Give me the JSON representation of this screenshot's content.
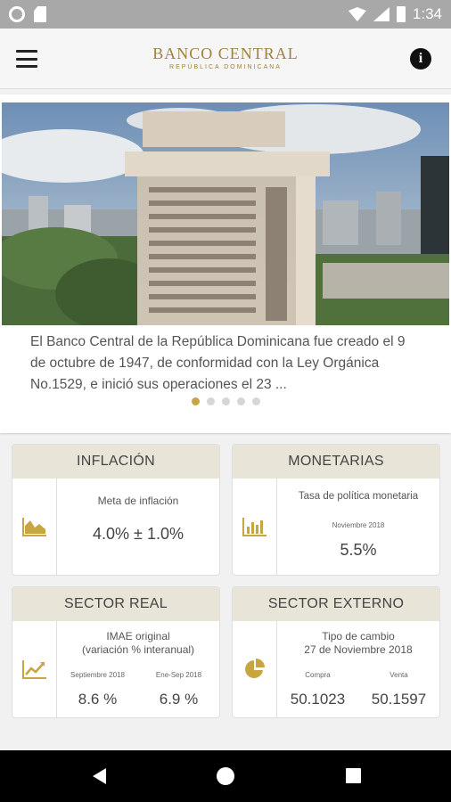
{
  "status_bar": {
    "time": "1:34"
  },
  "app_bar": {
    "title": "BANCO CENTRAL",
    "subtitle": "REPÚBLICA DOMINICANA",
    "info_label": "i"
  },
  "hero": {
    "text": "El Banco Central de la República Dominicana fue creado el 9 de octubre de 1947, de conformidad con la Ley Orgánica No.1529, e inició sus operaciones el 23 ...",
    "dots": 5,
    "active_dot": 0
  },
  "cards": {
    "inflacion": {
      "title": "INFLACIÓN",
      "icon": "area-chart-icon",
      "label": "Meta de inflación",
      "value": "4.0% ± 1.0%"
    },
    "monetarias": {
      "title": "MONETARIAS",
      "icon": "bar-chart-icon",
      "label": "Tasa de política monetaria",
      "period": "Noviembre 2018",
      "value": "5.5%"
    },
    "sector_real": {
      "title": "SECTOR REAL",
      "icon": "line-chart-icon",
      "label_line1": "IMAE original",
      "label_line2": "(variación % interanual)",
      "col1_label": "Septiembre 2018",
      "col1_value": "8.6 %",
      "col2_label": "Ene-Sep 2018",
      "col2_value": "6.9 %"
    },
    "sector_externo": {
      "title": "SECTOR EXTERNO",
      "icon": "pie-chart-icon",
      "label_line1": "Tipo de cambio",
      "label_line2": "27 de Noviembre 2018",
      "col1_label": "Compra",
      "col1_value": "50.1023",
      "col2_label": "Venta",
      "col2_value": "50.1597"
    }
  },
  "colors": {
    "accent": "#c8a543",
    "brand": "#9d8140",
    "card_header_bg": "#e9e4d8",
    "status_bar_bg": "#a8a8a8"
  }
}
